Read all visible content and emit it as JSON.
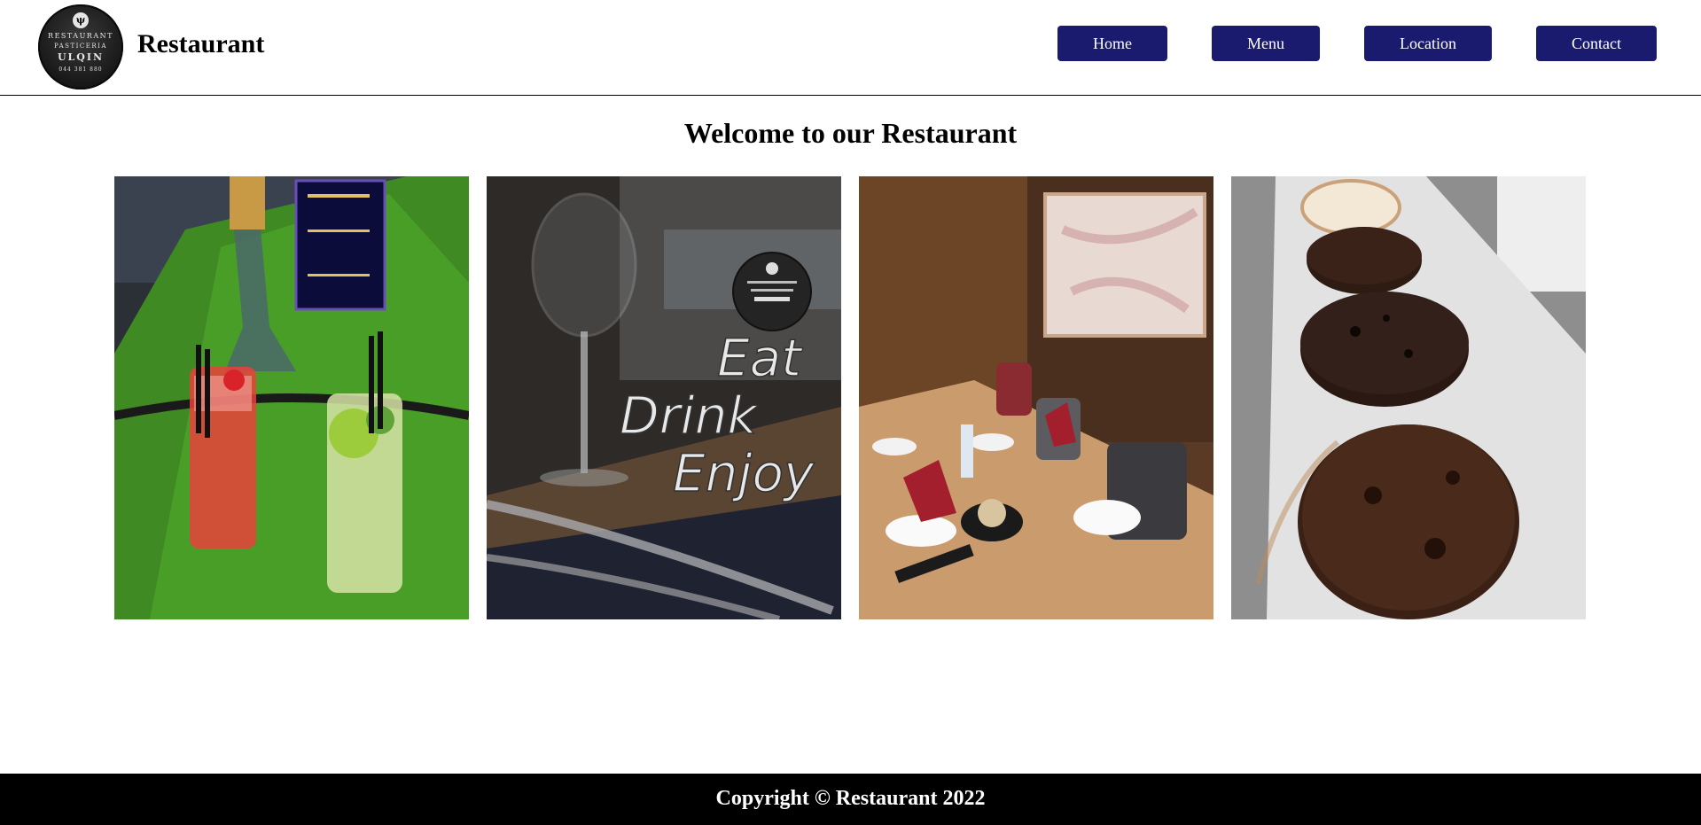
{
  "header": {
    "site_title": "Restaurant",
    "logo": {
      "line1": "RESTAURANT",
      "line2": "PASTICERIA",
      "line3": "ULQIN",
      "line4": "044 381 880"
    },
    "nav": [
      {
        "label": "Home"
      },
      {
        "label": "Menu"
      },
      {
        "label": "Location"
      },
      {
        "label": "Contact"
      }
    ],
    "nav_color": "#1a1a6e"
  },
  "main": {
    "heading": "Welcome to our Restaurant",
    "gallery": [
      {
        "subject": "cocktails-on-grass-table"
      },
      {
        "subject": "wine-glass-eat-drink-enjoy",
        "overlay_text": [
          "Eat",
          "Drink",
          "Enjoy"
        ]
      },
      {
        "subject": "set-dining-table"
      },
      {
        "subject": "chocolate-cakes"
      }
    ]
  },
  "footer": {
    "copyright": "Copyright © Restaurant 2022"
  }
}
